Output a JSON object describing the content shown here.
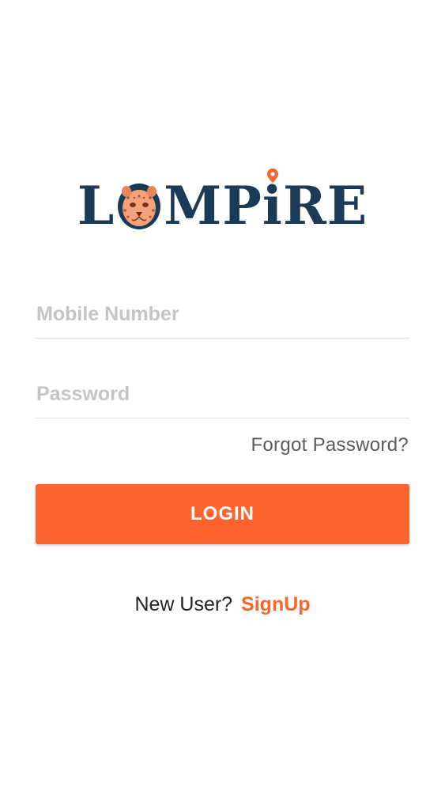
{
  "brand": {
    "logo_text_l": "L",
    "logo_text_mp": "MP",
    "logo_text_i": "i",
    "logo_text_re": "RE",
    "primary_color": "#1b3a57",
    "accent_color": "#fd642e"
  },
  "form": {
    "mobile_placeholder": "Mobile Number",
    "password_placeholder": "Password",
    "forgot_label": "Forgot Password?",
    "login_label": "LOGIN"
  },
  "signup": {
    "prompt": "New User?",
    "link_label": "SignUp"
  },
  "icons": {
    "logo_o": "leopard-face-icon",
    "logo_i_dot": "location-pin-icon"
  }
}
